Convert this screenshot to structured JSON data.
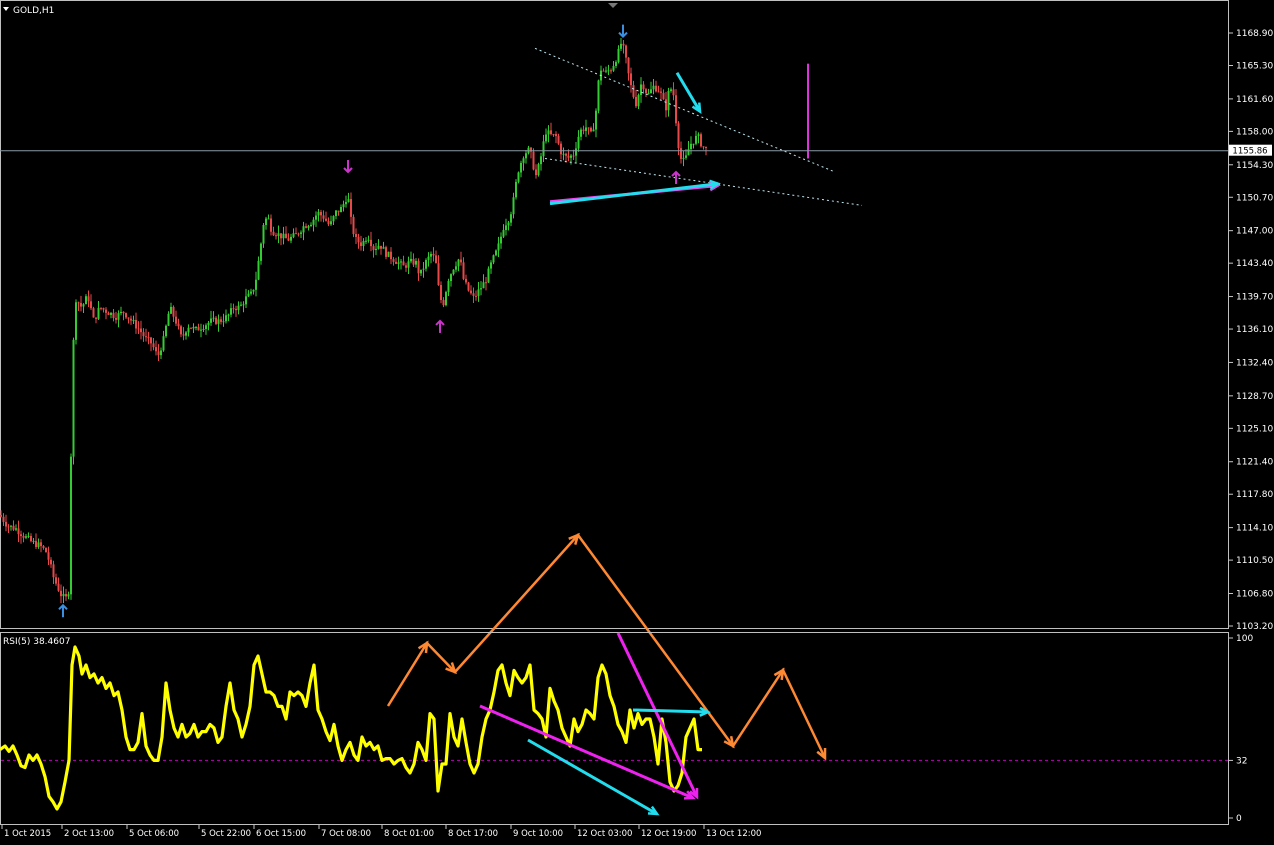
{
  "chart_data": [
    {
      "type": "candlestick",
      "title": "GOLD,H1",
      "ylim": [
        1103.2,
        1168.9
      ],
      "yticks": [
        "1168.90",
        "1165.30",
        "1161.60",
        "1158.00",
        "1154.30",
        "1150.70",
        "1147.00",
        "1143.40",
        "1139.70",
        "1136.10",
        "1132.40",
        "1128.70",
        "1125.10",
        "1121.40",
        "1117.80",
        "1114.10",
        "1110.50",
        "1106.80",
        "1103.20"
      ],
      "current_price": "1155.86",
      "current_price_value": 1155.86,
      "colors": {
        "bull": "#33cc33",
        "bear": "#e84848",
        "background": "#000000",
        "bid_line": "#8a9aa6"
      },
      "path_points": [
        [
          0,
          1115.5
        ],
        [
          8,
          1114.3
        ],
        [
          16,
          1114.0
        ],
        [
          24,
          1113.2
        ],
        [
          32,
          1112.5
        ],
        [
          40,
          1112.1
        ],
        [
          46,
          1111.5
        ],
        [
          50,
          1110.2
        ],
        [
          54,
          1108.5
        ],
        [
          58,
          1107.5
        ],
        [
          62,
          1106.5
        ],
        [
          66,
          1106.2
        ],
        [
          70,
          1107.5
        ],
        [
          72,
          1131.0
        ],
        [
          76,
          1139.5
        ],
        [
          82,
          1138.5
        ],
        [
          88,
          1139.8
        ],
        [
          94,
          1137.0
        ],
        [
          100,
          1138.5
        ],
        [
          108,
          1138.0
        ],
        [
          116,
          1137.5
        ],
        [
          124,
          1138.0
        ],
        [
          132,
          1137.0
        ],
        [
          140,
          1136.0
        ],
        [
          146,
          1135.0
        ],
        [
          152,
          1134.5
        ],
        [
          158,
          1133.0
        ],
        [
          164,
          1135.0
        ],
        [
          170,
          1138.5
        ],
        [
          176,
          1137.0
        ],
        [
          182,
          1135.0
        ],
        [
          188,
          1136.5
        ],
        [
          196,
          1136.0
        ],
        [
          204,
          1136.5
        ],
        [
          212,
          1137.0
        ],
        [
          220,
          1137.0
        ],
        [
          228,
          1137.5
        ],
        [
          234,
          1138.5
        ],
        [
          240,
          1138.5
        ],
        [
          246,
          1139.5
        ],
        [
          252,
          1140.0
        ],
        [
          256,
          1141.5
        ],
        [
          260,
          1144.5
        ],
        [
          264,
          1148.0
        ],
        [
          268,
          1148.5
        ],
        [
          272,
          1147.0
        ],
        [
          280,
          1146.5
        ],
        [
          288,
          1146.0
        ],
        [
          296,
          1146.5
        ],
        [
          304,
          1147.5
        ],
        [
          312,
          1148.0
        ],
        [
          318,
          1149.0
        ],
        [
          324,
          1148.5
        ],
        [
          330,
          1147.5
        ],
        [
          336,
          1149.0
        ],
        [
          342,
          1149.5
        ],
        [
          348,
          1151.0
        ],
        [
          352,
          1147.5
        ],
        [
          356,
          1146.0
        ],
        [
          362,
          1145.5
        ],
        [
          368,
          1146.5
        ],
        [
          374,
          1145.0
        ],
        [
          380,
          1145.5
        ],
        [
          386,
          1144.5
        ],
        [
          392,
          1144.0
        ],
        [
          398,
          1143.5
        ],
        [
          404,
          1143.0
        ],
        [
          410,
          1143.5
        ],
        [
          416,
          1143.5
        ],
        [
          420,
          1142.0
        ],
        [
          426,
          1143.5
        ],
        [
          432,
          1144.5
        ],
        [
          436,
          1143.5
        ],
        [
          440,
          1139.5
        ],
        [
          444,
          1139.0
        ],
        [
          448,
          1141.5
        ],
        [
          454,
          1143.0
        ],
        [
          460,
          1144.0
        ],
        [
          464,
          1141.5
        ],
        [
          468,
          1140.5
        ],
        [
          474,
          1139.5
        ],
        [
          480,
          1140.5
        ],
        [
          486,
          1141.5
        ],
        [
          492,
          1143.5
        ],
        [
          498,
          1145.0
        ],
        [
          504,
          1147.5
        ],
        [
          510,
          1148.5
        ],
        [
          514,
          1150.5
        ],
        [
          518,
          1153.5
        ],
        [
          524,
          1155.5
        ],
        [
          530,
          1156.0
        ],
        [
          536,
          1153.0
        ],
        [
          540,
          1154.5
        ],
        [
          546,
          1158.0
        ],
        [
          552,
          1157.5
        ],
        [
          556,
          1157.5
        ],
        [
          562,
          1155.5
        ],
        [
          568,
          1155.0
        ],
        [
          574,
          1155.5
        ],
        [
          580,
          1158.0
        ],
        [
          586,
          1158.5
        ],
        [
          592,
          1157.5
        ],
        [
          596,
          1160.0
        ],
        [
          600,
          1165.0
        ],
        [
          606,
          1164.5
        ],
        [
          612,
          1165.0
        ],
        [
          618,
          1166.5
        ],
        [
          622,
          1168.0
        ],
        [
          626,
          1166.0
        ],
        [
          630,
          1163.5
        ],
        [
          636,
          1161.0
        ],
        [
          642,
          1163.5
        ],
        [
          648,
          1162.0
        ],
        [
          654,
          1163.0
        ],
        [
          660,
          1162.5
        ],
        [
          666,
          1160.5
        ],
        [
          670,
          1163.0
        ],
        [
          674,
          1162.0
        ],
        [
          678,
          1157.0
        ],
        [
          682,
          1154.5
        ],
        [
          686,
          1155.0
        ],
        [
          690,
          1156.5
        ],
        [
          694,
          1157.0
        ],
        [
          698,
          1157.5
        ],
        [
          702,
          1156.5
        ],
        [
          706,
          1156.0
        ]
      ],
      "annotations": {
        "resistance_trendline": [
          [
            535,
            1167.2
          ],
          [
            835,
            1153.5
          ]
        ],
        "support_trendline": [
          [
            545,
            1155.0
          ],
          [
            862,
            1149.8
          ]
        ],
        "down_arrows": [
          [
            623,
            1168.5,
            "#3b8fe0"
          ],
          [
            348,
            1153.5,
            "#cc33cc"
          ]
        ],
        "up_arrows": [
          [
            63,
            1105.5,
            "#3b8fe0"
          ],
          [
            440,
            1137.0,
            "#cc33cc"
          ],
          [
            676,
            1153.5,
            "#cc33cc"
          ]
        ],
        "vertical_marker": [
          808,
          1165.5,
          1155.0,
          "#dd33dd"
        ],
        "arrows": [
          [
            [
              550,
              1150.2
            ],
            [
              718,
              1152.0
            ],
            "#ee44ee"
          ],
          [
            [
              550,
              1150.0
            ],
            [
              718,
              1152.2
            ],
            "#22ddee"
          ],
          [
            [
              677,
              1164.5
            ],
            [
              700,
              1160.2
            ],
            "#22ddee"
          ]
        ]
      }
    },
    {
      "type": "line",
      "title": "RSI(5) 38.4607",
      "ylim": [
        0,
        100
      ],
      "yticks": [
        "100",
        "32",
        "0"
      ],
      "level": 32,
      "colors": {
        "line": "#ffff00",
        "level": "#bb00bb"
      },
      "x": [
        0,
        5,
        9,
        13,
        17,
        21,
        25,
        29,
        33,
        37,
        41,
        45,
        49,
        53,
        57,
        61,
        65,
        69,
        72,
        75,
        79,
        82,
        86,
        90,
        94,
        98,
        102,
        106,
        110,
        114,
        118,
        122,
        126,
        130,
        134,
        138,
        142,
        146,
        150,
        154,
        158,
        162,
        166,
        170,
        174,
        178,
        182,
        186,
        190,
        194,
        198,
        202,
        206,
        210,
        214,
        218,
        222,
        226,
        230,
        234,
        238,
        242,
        246,
        250,
        254,
        258,
        262,
        266,
        270,
        274,
        278,
        282,
        286,
        290,
        294,
        298,
        302,
        306,
        310,
        314,
        318,
        322,
        326,
        330,
        334,
        338,
        342,
        346,
        350,
        354,
        358,
        362,
        366,
        370,
        374,
        378,
        382,
        386,
        390,
        394,
        398,
        402,
        406,
        410,
        414,
        418,
        422,
        426,
        430,
        434,
        438,
        442,
        446,
        450,
        454,
        458,
        462,
        466,
        470,
        474,
        478,
        482,
        486,
        490,
        494,
        498,
        502,
        506,
        510,
        514,
        518,
        522,
        526,
        530,
        534,
        538,
        542,
        546,
        550,
        554,
        558,
        562,
        566,
        570,
        574,
        578,
        582,
        586,
        590,
        594,
        598,
        602,
        606,
        610,
        614,
        618,
        622,
        626,
        630,
        634,
        638,
        642,
        646,
        650,
        654,
        658,
        662,
        666,
        670,
        674,
        678,
        682,
        686,
        690,
        694,
        698,
        702,
        706
      ],
      "values": [
        38,
        40,
        37,
        40,
        35,
        29,
        28,
        35,
        32,
        35,
        30,
        23,
        12,
        9,
        5,
        9,
        20,
        32,
        85,
        95,
        90,
        80,
        85,
        78,
        80,
        75,
        78,
        72,
        75,
        68,
        70,
        60,
        45,
        38,
        38,
        42,
        58,
        40,
        35,
        32,
        32,
        45,
        75,
        60,
        50,
        45,
        52,
        45,
        47,
        52,
        45,
        48,
        48,
        52,
        50,
        42,
        45,
        62,
        75,
        60,
        55,
        45,
        52,
        62,
        85,
        90,
        80,
        70,
        70,
        68,
        62,
        62,
        55,
        70,
        68,
        70,
        68,
        62,
        75,
        85,
        60,
        55,
        48,
        43,
        52,
        40,
        32,
        38,
        42,
        35,
        32,
        45,
        40,
        42,
        38,
        40,
        32,
        33,
        33,
        30,
        32,
        33,
        28,
        25,
        30,
        42,
        38,
        32,
        58,
        55,
        15,
        30,
        30,
        58,
        45,
        40,
        55,
        42,
        30,
        25,
        30,
        45,
        55,
        60,
        70,
        82,
        85,
        75,
        68,
        82,
        78,
        75,
        78,
        85,
        60,
        58,
        55,
        45,
        72,
        65,
        60,
        50,
        45,
        40,
        55,
        48,
        52,
        60,
        58,
        55,
        78,
        85,
        80,
        68,
        62,
        52,
        48,
        42,
        60,
        50,
        58,
        52,
        55,
        55,
        45,
        30,
        55,
        42,
        20,
        15,
        18,
        25,
        45,
        50,
        55,
        38,
        38
      ]
    }
  ],
  "x_axis_labels": [
    "1 Oct 2015",
    "2 Oct 13:00",
    "5 Oct 06:00",
    "5 Oct 22:00",
    "6 Oct 15:00",
    "7 Oct 08:00",
    "8 Oct 01:00",
    "8 Oct 17:00",
    "9 Oct 10:00",
    "12 Oct 03:00",
    "12 Oct 19:00",
    "13 Oct 12:00"
  ],
  "overlay_colors": {
    "zigzag": "#ff8833",
    "cyan": "#22ddee",
    "magenta": "#ee22ee"
  }
}
